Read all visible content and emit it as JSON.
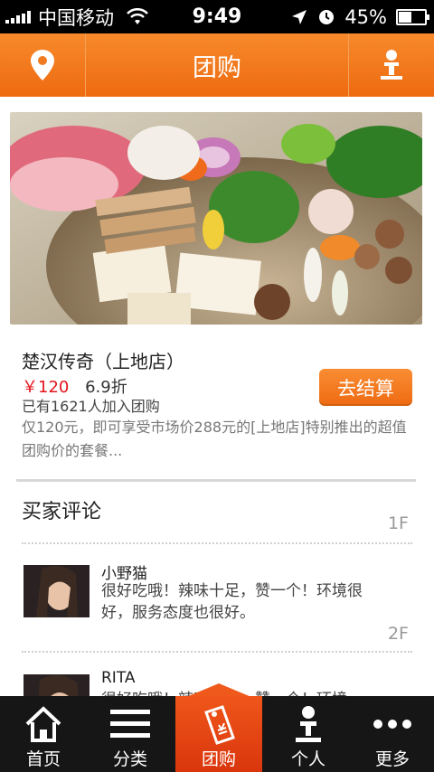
{
  "status_bar": {
    "carrier": "中国移动",
    "time": "9:49",
    "battery": "45%",
    "battery_level": 0.45
  },
  "nav": {
    "title": "团购",
    "left_icon": "location-pin-icon",
    "right_icon": "person-icon"
  },
  "deal": {
    "name": "楚汉传奇（上地店）",
    "price": "￥120",
    "discount": "6.9折",
    "sold_text": "已有1621人加入团购",
    "checkout_label": "去结算",
    "description": "仅120元，即可享受市场价288元的[上地店]特别推出的超值团购价的套餐..."
  },
  "reviews": {
    "section_title": "买家评论",
    "items": [
      {
        "floor": "1F",
        "user": "小野猫",
        "comment": "很好吃哦！辣味十足，赞一个！环境很好，服务态度也很好。"
      },
      {
        "floor": "2F",
        "user": "RITA",
        "comment": "很好吃哦！辣味十足，赞一个！环境"
      }
    ]
  },
  "tabbar": {
    "tabs": [
      {
        "label": "首页",
        "icon": "home-icon"
      },
      {
        "label": "分类",
        "icon": "list-icon"
      },
      {
        "label": "团购",
        "icon": "tag-icon"
      },
      {
        "label": "个人",
        "icon": "person-icon"
      },
      {
        "label": "更多",
        "icon": "more-dots-icon"
      }
    ],
    "active_index": 2
  },
  "colors": {
    "accent": "#f07a1e",
    "price": "#e3141b",
    "tabbar_bg": "#161616"
  }
}
